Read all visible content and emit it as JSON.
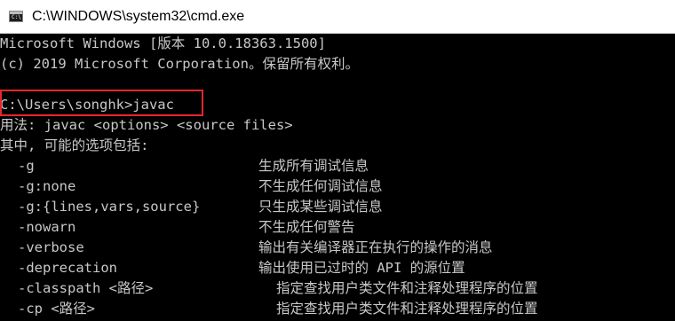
{
  "window": {
    "title": "C:\\WINDOWS\\system32\\cmd.exe",
    "icon": "cmd-icon"
  },
  "console": {
    "banner_line1": "Microsoft Windows [版本 10.0.18363.1500]",
    "banner_line2": "(c) 2019 Microsoft Corporation。保留所有权利。",
    "prompt_command": "C:\\Users\\songhk>javac",
    "usage_line": "用法: javac <options> <source files>",
    "options_header": "其中, 可能的选项包括:",
    "options": [
      {
        "flag": "-g",
        "description": "生成所有调试信息"
      },
      {
        "flag": "-g:none",
        "description": "不生成任何调试信息"
      },
      {
        "flag": "-g:{lines,vars,source}",
        "description": "只生成某些调试信息"
      },
      {
        "flag": "-nowarn",
        "description": "不生成任何警告"
      },
      {
        "flag": "-verbose",
        "description": "输出有关编译器正在执行的操作的消息"
      },
      {
        "flag": "-deprecation",
        "description": "输出使用已过时的 API 的源位置"
      },
      {
        "flag": "-classpath <路径>",
        "description": "指定查找用户类文件和注释处理程序的位置"
      },
      {
        "flag": "-cp <路径>",
        "description": "指定查找用户类文件和注释处理程序的位置"
      }
    ],
    "text_color": "#c8c8c8",
    "background_color": "#000000",
    "highlight_color": "#e8262e"
  }
}
